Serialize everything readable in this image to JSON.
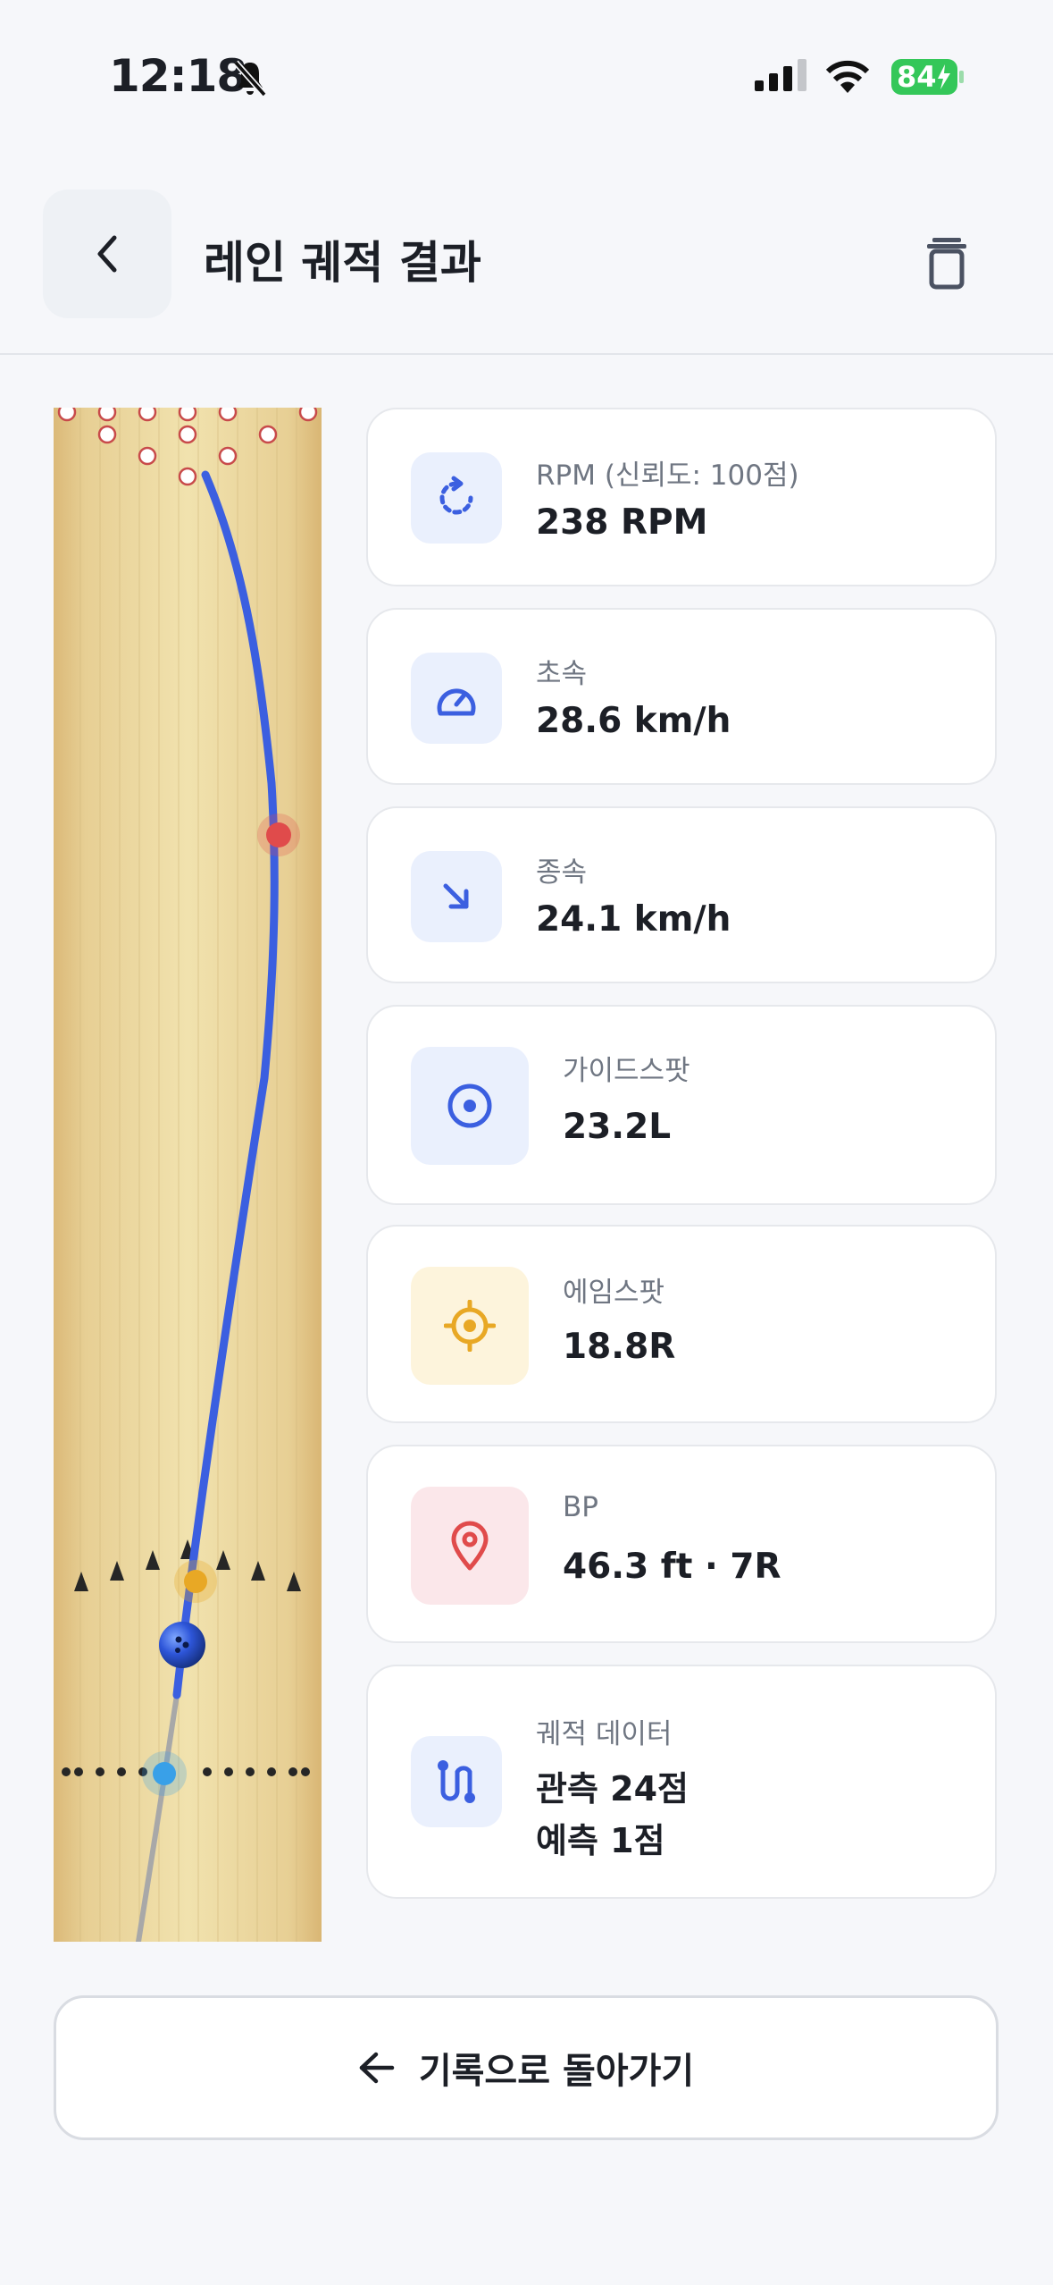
{
  "status_bar": {
    "time": "12:18",
    "battery": "84"
  },
  "header": {
    "title": "레인 궤적 결과"
  },
  "cards": {
    "rpm": {
      "label": "RPM (신뢰도: 100점)",
      "value": "238 RPM"
    },
    "initial_speed": {
      "label": "초속",
      "value": "28.6 km/h"
    },
    "final_speed": {
      "label": "종속",
      "value": "24.1 km/h"
    },
    "guide_spot": {
      "label": "가이드스팟",
      "value": "23.2L"
    },
    "aim_spot": {
      "label": "에임스팟",
      "value": "18.8R"
    },
    "breakpoint": {
      "label": "BP",
      "value": "46.3 ft · 7R"
    },
    "trajectory": {
      "label": "궤적 데이터",
      "observed": "관측 24점",
      "predicted": "예측 1점"
    }
  },
  "footer": {
    "return_label": "기록으로 돌아가기"
  },
  "colors": {
    "accent_blue": "#3b5fe0",
    "aim_gold": "#e8a825",
    "breakpoint_red": "#e04b4b",
    "lane_wood": "#e9d49a"
  }
}
